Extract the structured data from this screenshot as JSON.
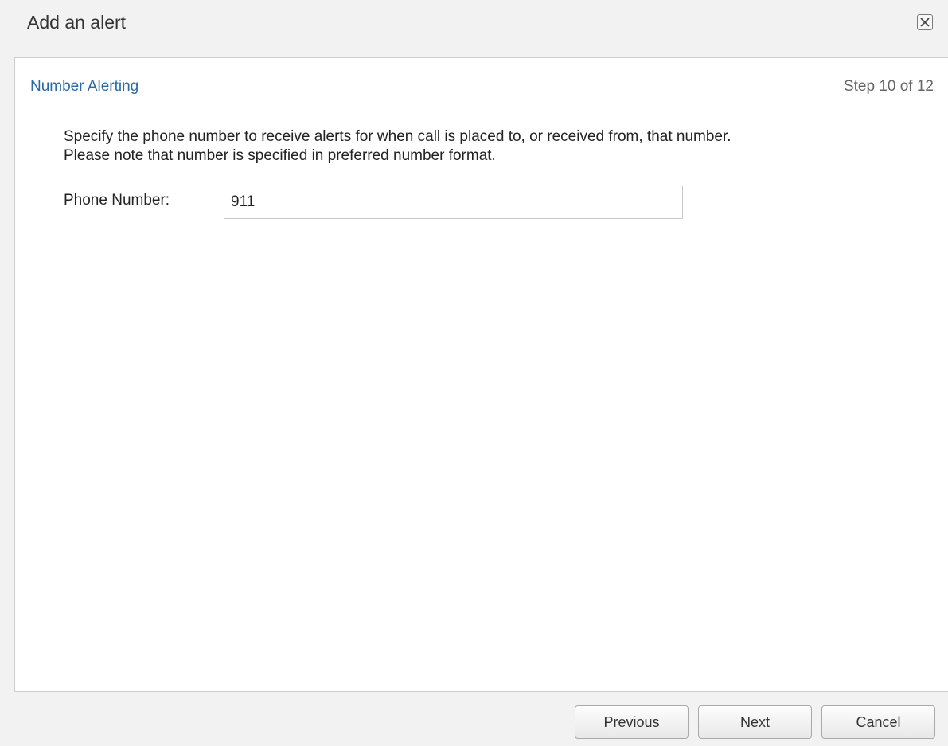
{
  "dialog": {
    "title": "Add an alert",
    "close_icon": "close-icon"
  },
  "panel": {
    "section_title": "Number Alerting",
    "step": "Step 10 of 12",
    "instructions": [
      "Specify the phone number to receive alerts for when call is placed to, or received from, that number.",
      "Please note that number is specified in preferred number format."
    ],
    "phone_label": "Phone Number:",
    "phone_value": "911"
  },
  "footer": {
    "previous_label": "Previous",
    "next_label": "Next",
    "cancel_label": "Cancel"
  },
  "colors": {
    "accent": "#2a6aa6",
    "background": "#f2f2f2",
    "panel": "#ffffff"
  }
}
